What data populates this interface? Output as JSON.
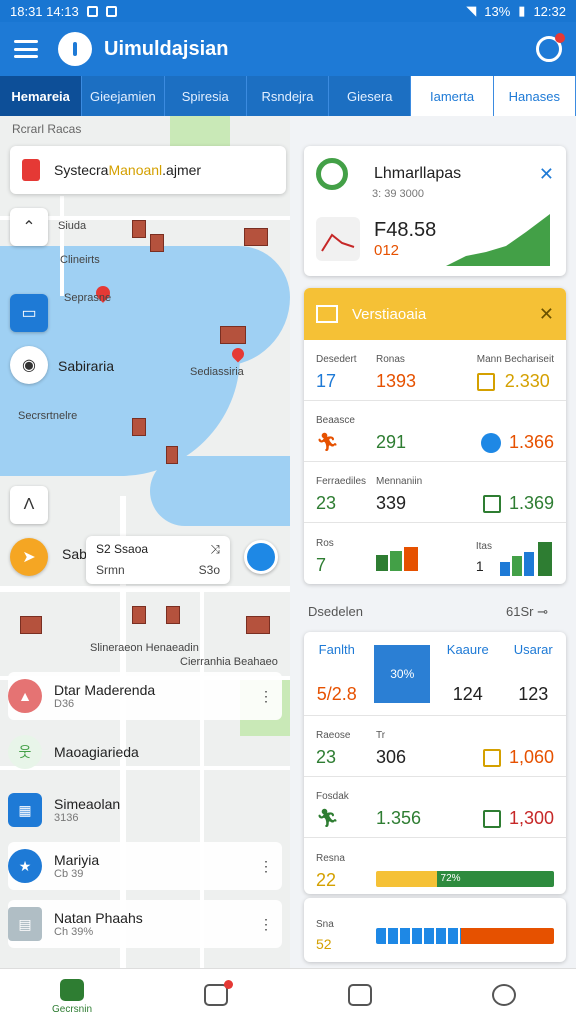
{
  "status": {
    "time_left": "18:31 14:13",
    "battery": "13%",
    "time_right": "12:32"
  },
  "appbar": {
    "title": "Uimuldajsian"
  },
  "tabs": [
    {
      "label": "Hemareia"
    },
    {
      "label": "Gieejamien"
    },
    {
      "label": "Spiresia"
    },
    {
      "label": "Rsndejra"
    },
    {
      "label": "Giesera"
    },
    {
      "label": "Iamerta"
    },
    {
      "label": "Hanases"
    }
  ],
  "map": {
    "top_label": "Rcrarl Racas",
    "search": {
      "prefix": "Systecra ",
      "highlight": "Manoanl",
      "suffix": ".ajmer"
    },
    "labels": {
      "a": "Siuda",
      "b": "Clineirts",
      "c": "Seprasne",
      "d": "Sabiraria",
      "e": "Sediassiria",
      "f": "Secrsrtnelre",
      "g": "Sabi",
      "h": "Slineraeon Henaeadin",
      "i": "Cierranhia Beahaeo"
    },
    "popup": {
      "title": "S2 Ssaoa",
      "icon": "⤨",
      "sub_left": "Srmn",
      "sub_right": "S3o"
    }
  },
  "list": [
    {
      "title": "Dtar Maderenda",
      "sub": "D36",
      "color": "#e57373"
    },
    {
      "title": "Maoagiarieda",
      "sub": "",
      "color": "#66bb6a"
    },
    {
      "title": "Simeaolan",
      "sub": "3136",
      "color": "#1e7ad6"
    },
    {
      "title": "Mariyia",
      "sub": "Cb 39",
      "color": "#1e7ad6"
    },
    {
      "title": "Natan Phaahs",
      "sub": "Ch 39%",
      "color": "#90a4ae"
    }
  ],
  "tile1": {
    "title": "Lhmarllapas",
    "sub": "3: 39 3000",
    "value": "F48.58",
    "delta": "012",
    "ring_color": "#43a047"
  },
  "tile2": {
    "header": "Verstiaoaia",
    "rows": [
      {
        "lab1": "Desedert",
        "val1": "17",
        "lab2": "Ronas",
        "val2": "1393",
        "val2_color": "#e65100",
        "lab3": "Mann Bechariseit",
        "val3": "2.330",
        "val3_color": "#d4a000"
      },
      {
        "lab1": "Beaasce",
        "val1": "",
        "lab2": "",
        "val2": "291",
        "val2_color": "#2e7d32",
        "lab3": "",
        "val3": "1.366",
        "val3_color": "#e65100"
      },
      {
        "lab1": "Ferraediles",
        "val1": "23",
        "lab2": "Mennaniin",
        "val2": "339",
        "val2_color": "#222",
        "lab3": "",
        "val3": "1.369",
        "val3_color": "#2e7d32"
      },
      {
        "lab1": "Ros",
        "val1": "7",
        "lab2": "",
        "val2": "",
        "val2_color": "#222",
        "lab3": "Itas",
        "val3": "1",
        "val3_color": "#333"
      }
    ]
  },
  "section": {
    "left": "Dsedelen",
    "right": "61Sr"
  },
  "tile3": {
    "cols": [
      {
        "label": "Fanlth",
        "num": "5/2.8"
      },
      {
        "label": "",
        "num": "30%"
      },
      {
        "label": "Kaaure",
        "num": "124"
      },
      {
        "label": "Usarar",
        "num": "123"
      }
    ],
    "rows": [
      {
        "lab1": "Raeose",
        "val1": "23",
        "lab2": "Tr",
        "val2": "306",
        "val3": "1,060"
      },
      {
        "lab1": "Fosdak",
        "val1": "",
        "lab2": "",
        "val2": "1.356",
        "val3": "1,300"
      },
      {
        "lab1": "Resna",
        "val1": "22",
        "lab2": "",
        "val2": "",
        "val3": "72%"
      }
    ]
  },
  "tile4": {
    "lab": "Sna",
    "val": "52"
  },
  "bottomnav": [
    {
      "label": "Gecrsnin"
    },
    {
      "label": ""
    },
    {
      "label": ""
    },
    {
      "label": ""
    }
  ]
}
